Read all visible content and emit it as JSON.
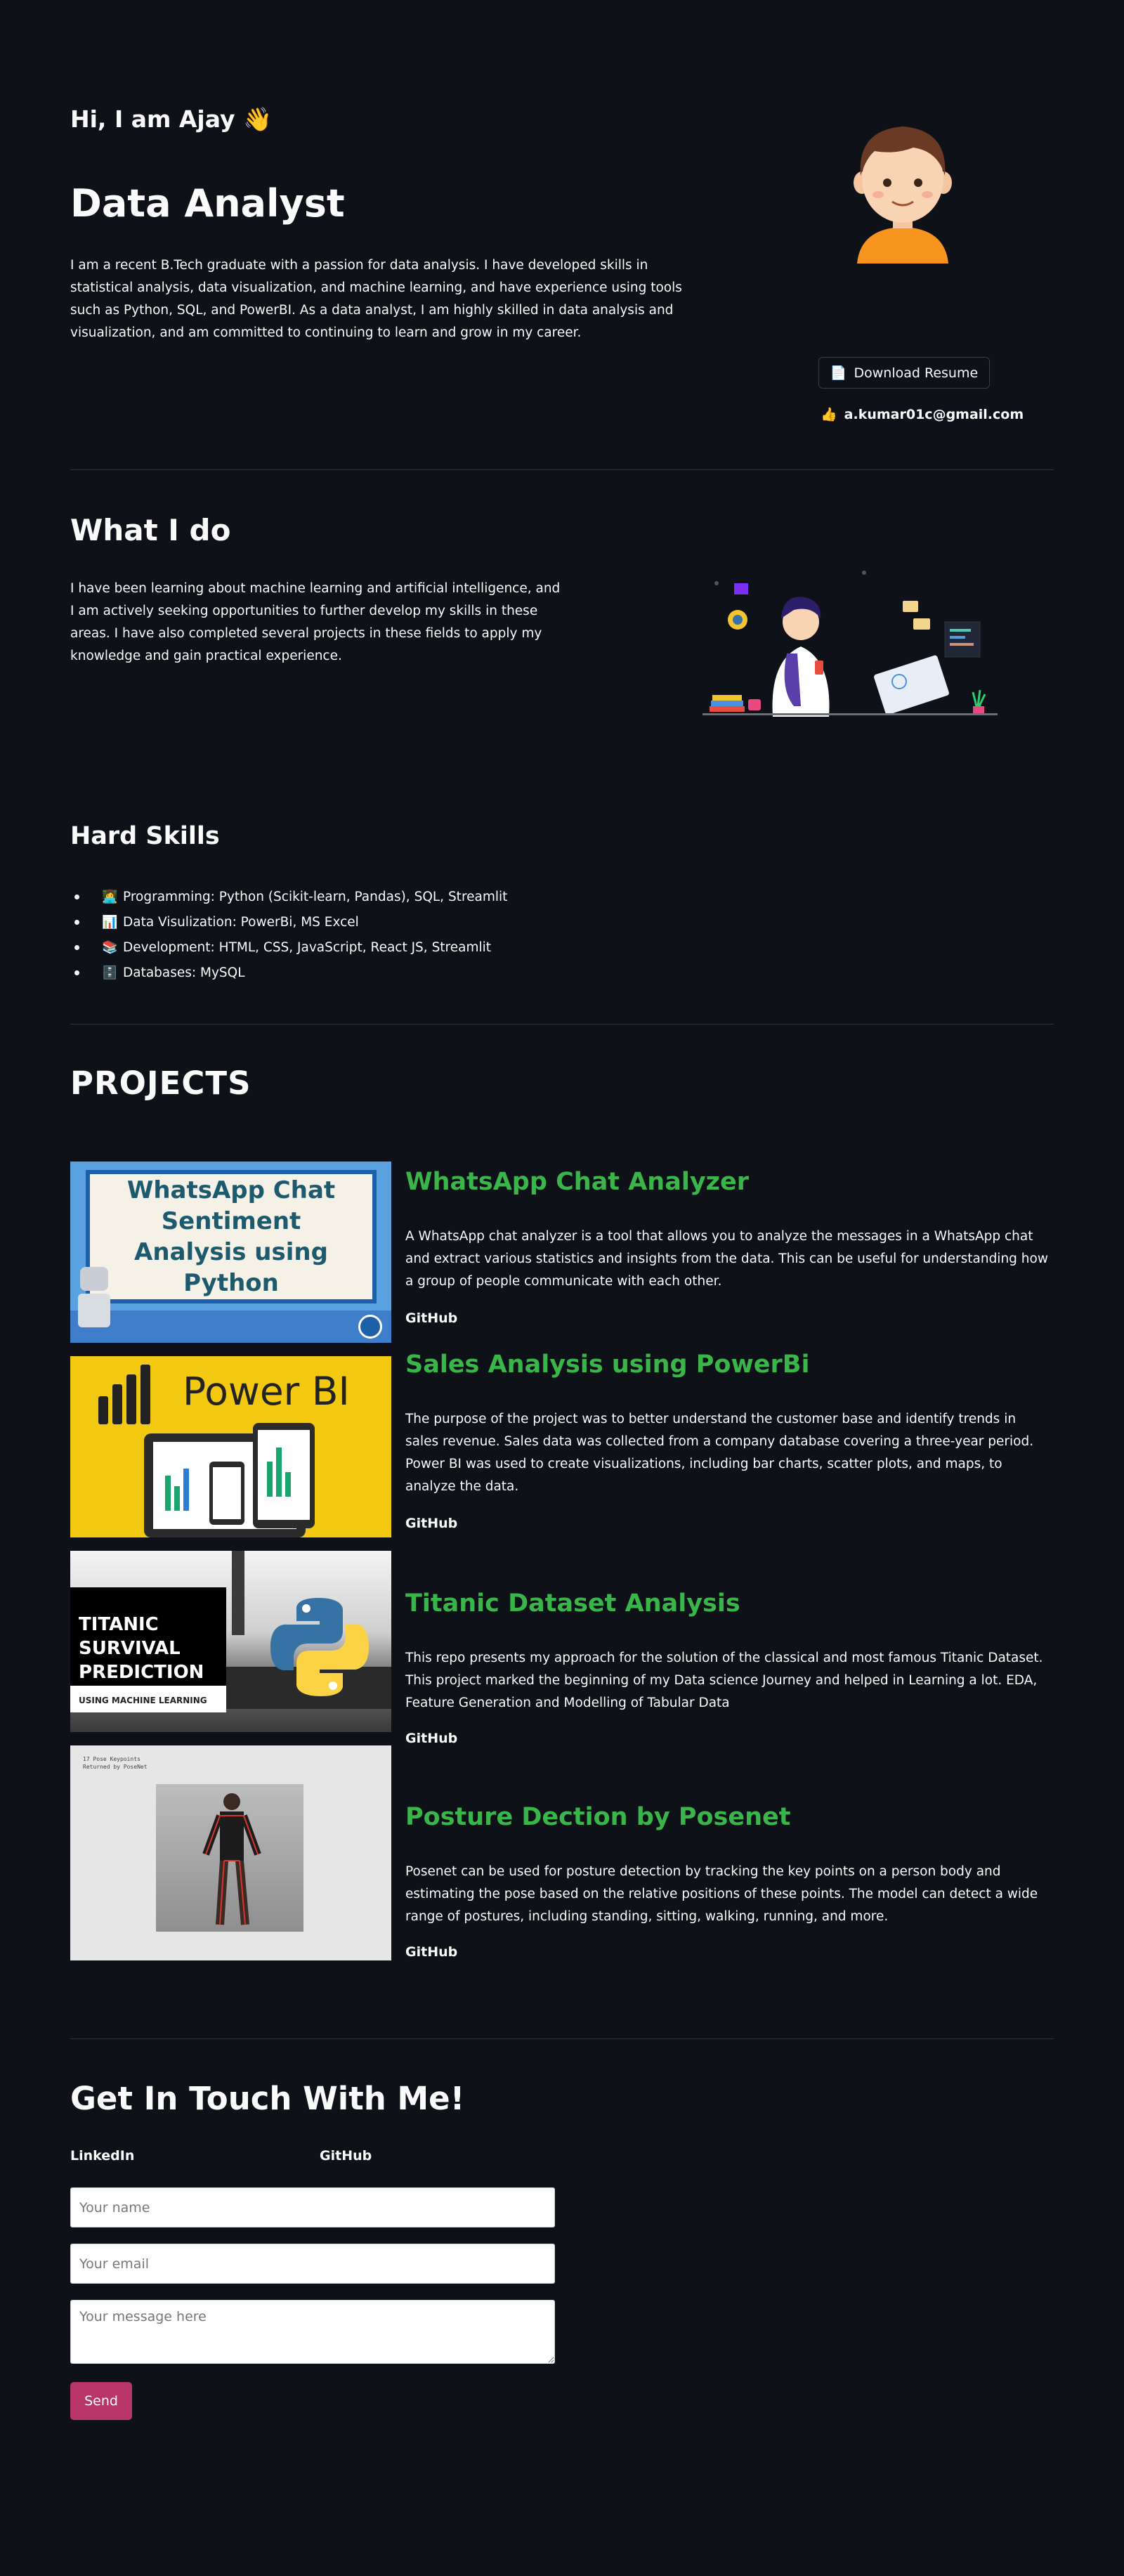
{
  "hero": {
    "greeting": "Hi, I am Ajay 👋",
    "role": "Data Analyst",
    "intro": "I am a recent B.Tech graduate with a passion for data analysis. I have developed skills in statistical analysis, data visualization, and machine learning, and have experience using tools such as Python, SQL, and PowerBI. As a data analyst, I am highly skilled in data analysis and visualization, and am committed to continuing to learn and grow in my career.",
    "resume_label": "Download Resume",
    "email": "a.kumar01c@gmail.com"
  },
  "what_i_do": {
    "heading": "What I do",
    "text": "I have been learning about machine learning and artificial intelligence, and I am actively seeking opportunities to further develop my skills in these areas. I have also completed several projects in these fields to apply my knowledge and gain practical experience."
  },
  "skills": {
    "heading": "Hard Skills",
    "items": [
      {
        "icon": "👩‍💻",
        "text": "Programming: Python (Scikit-learn, Pandas), SQL, Streamlit"
      },
      {
        "icon": "📊",
        "text": "Data Visulization: PowerBi, MS Excel"
      },
      {
        "icon": "📚",
        "text": "Development: HTML, CSS, JavaScript, React JS, Streamlit"
      },
      {
        "icon": "🗄️",
        "text": "Databases: MySQL"
      }
    ]
  },
  "projects": {
    "heading": "PROJECTS",
    "items": [
      {
        "title": "WhatsApp Chat Analyzer",
        "description": "A WhatsApp chat analyzer is a tool that allows you to analyze the messages in a WhatsApp chat and extract various statistics and insights from the data. This can be useful for understanding how a group of people communicate with each other.",
        "link": "GitHub",
        "thumb_text": "WhatsApp Chat Sentiment Analysis using Python"
      },
      {
        "title": "Sales Analysis using PowerBi",
        "description": "The purpose of the project was to better understand the customer base and identify trends in sales revenue. Sales data was collected from a company database covering a three-year period. Power BI was used to create visualizations, including bar charts, scatter plots, and maps, to analyze the data.",
        "link": "GitHub",
        "thumb_text": "Power BI"
      },
      {
        "title": "Titanic Dataset Analysis",
        "description": "This repo presents my approach for the solution of the classical and most famous Titanic Dataset. This project marked the beginning of my Data science Journey and helped in Learning a lot. EDA, Feature Generation and Modelling of Tabular Data",
        "link": "GitHub",
        "thumb_text": "TITANIC SURVIVAL PREDICTION",
        "thumb_sub": "USING MACHINE LEARNING"
      },
      {
        "title": "Posture Dection by Posenet",
        "description": "Posenet can be used for posture detection by tracking the key points on a person body and estimating the pose based on the relative positions of these points. The model can detect a wide range of postures, including standing, sitting, walking, running, and more.",
        "link": "GitHub",
        "thumb_text": "17 Pose Keypoints Returned by PoseNet"
      }
    ]
  },
  "contact": {
    "heading": "Get In Touch With Me!",
    "linkedin": "LinkedIn",
    "github": "GitHub",
    "name_placeholder": "Your name",
    "email_placeholder": "Your email",
    "message_placeholder": "Your message here",
    "send_label": "Send"
  },
  "colors": {
    "background": "#0e1117",
    "project_title": "#39b54a",
    "send_button": "#b83567"
  }
}
